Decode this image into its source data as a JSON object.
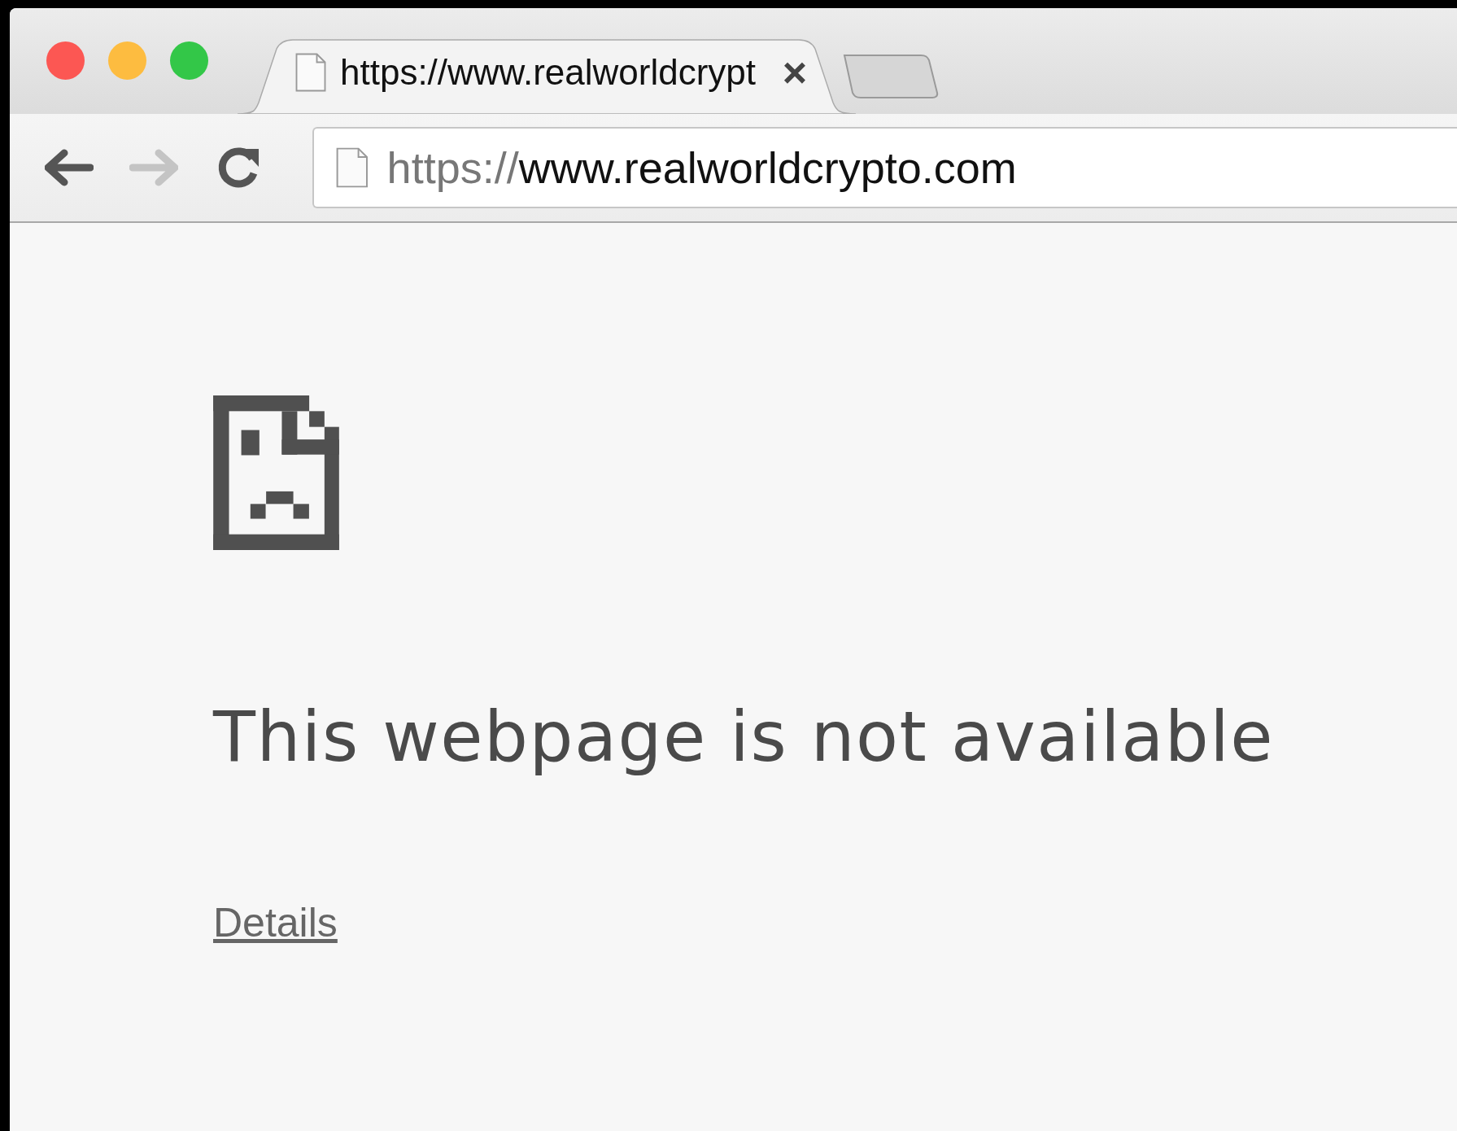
{
  "tabs": [
    {
      "title": "https://www.realworldcrypt",
      "close": "×",
      "selected": true
    }
  ],
  "address_bar": {
    "scheme": "https://",
    "host": "www.realworldcrypto.com"
  },
  "nav": {
    "back_disabled": false,
    "forward_disabled": true
  },
  "error": {
    "heading": "This webpage is not available",
    "details_link": "Details"
  }
}
